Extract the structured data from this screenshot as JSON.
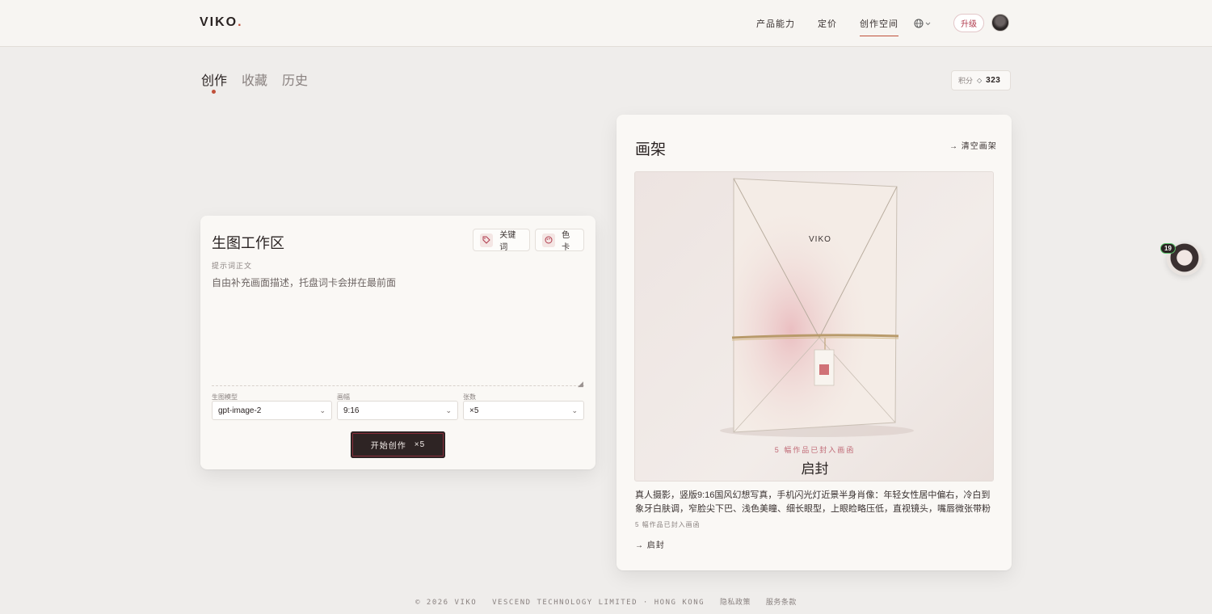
{
  "header": {
    "logo_text": "VIKO",
    "logo_dot": ".",
    "nav": [
      "产品能力",
      "定价",
      "创作空间"
    ],
    "active_nav": "创作空间",
    "upgrade_label": "升级"
  },
  "tabs": [
    "创作",
    "收藏",
    "历史"
  ],
  "points": {
    "label": "积分",
    "icon": "◇",
    "value": "323"
  },
  "workspace": {
    "title": "生图工作区",
    "keyword_chip": "关键词",
    "color_chip": "色卡",
    "prompt_label": "提示词正文",
    "prompt_placeholder": "自由补充画面描述，托盘词卡会拼在最前面",
    "prompt_value": "",
    "model_label": "生图模型",
    "model_value": "gpt-image-2",
    "ratio_label": "画幅",
    "ratio_value": "9:16",
    "count_label": "张数",
    "count_value": "×5",
    "start_label": "开始创作",
    "start_count": "×5"
  },
  "easel": {
    "title": "画架",
    "clear_label": "→ 清空画架",
    "envelope_brand": "VIKO",
    "sealed_text": "5  幅作品已封入画函",
    "open_title": "启封",
    "description": "真人摄影，竖版9:16国风幻想写真，手机闪光灯近景半身肖像：年轻女性居中偏右，冷白到象牙白肤调，窄脸尖下巴、浅色美瞳、细长眼型，上眼睑略压低，直视镜头，嘴唇微张带粉色水润光。…",
    "sub_text": "5  幅作品已封入画函",
    "open_link": "→  启封"
  },
  "mascot": {
    "badge": "19"
  },
  "footer": {
    "copyright": "© 2026 VIKO",
    "company": "VESCEND TECHNOLOGY LIMITED · HONG KONG",
    "privacy": "隐私政策",
    "terms": "服务条款"
  }
}
